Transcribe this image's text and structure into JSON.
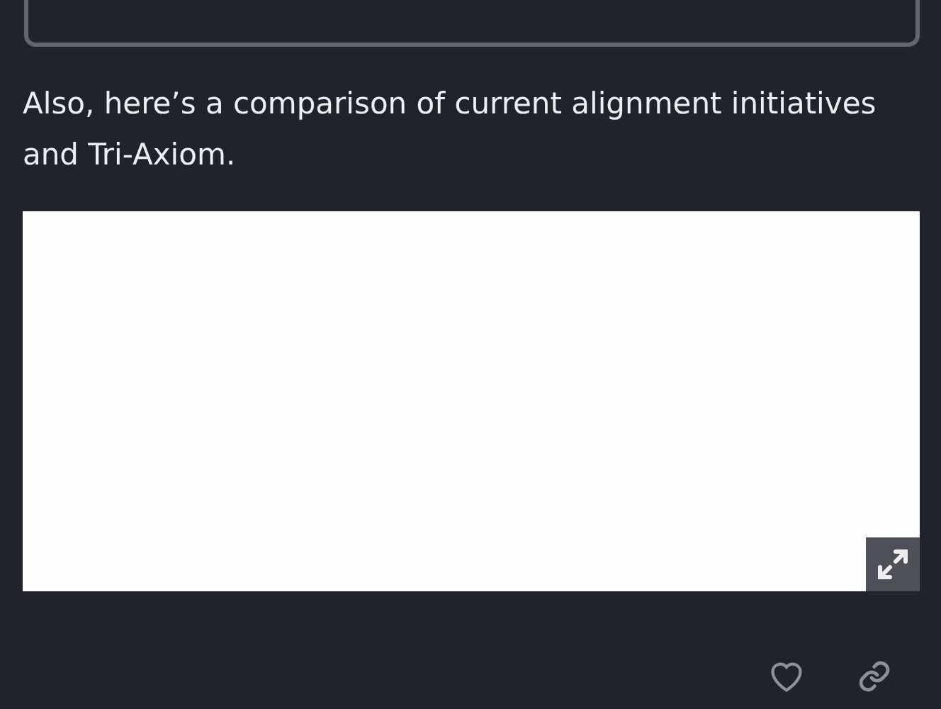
{
  "post": {
    "paragraph": "Also, here’s a comparison of current alignment initiatives and Tri-Axiom."
  }
}
